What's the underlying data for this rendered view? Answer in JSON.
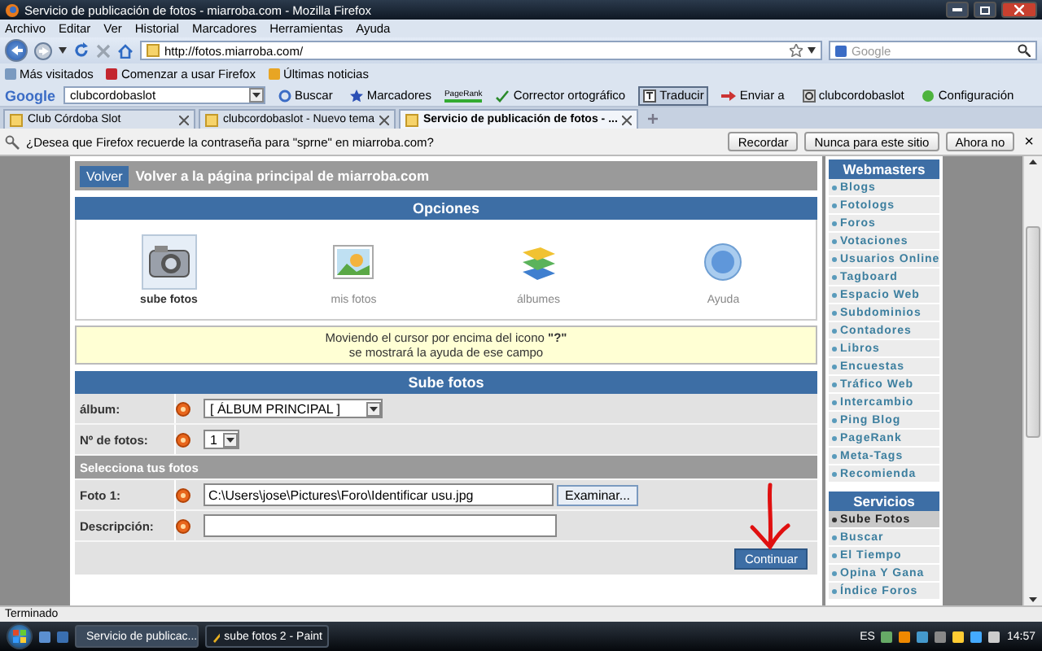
{
  "window": {
    "title": "Servicio de publicación de fotos - miarroba.com - Mozilla Firefox"
  },
  "menu": [
    "Archivo",
    "Editar",
    "Ver",
    "Historial",
    "Marcadores",
    "Herramientas",
    "Ayuda"
  ],
  "address_bar": {
    "url": "http://fotos.miarroba.com/"
  },
  "search_field": {
    "placeholder": "Google"
  },
  "bookmarks": [
    "Más visitados",
    "Comenzar a usar Firefox",
    "Últimas noticias"
  ],
  "google_toolbar": {
    "logo": "Google",
    "query": "clubcordobaslot",
    "items": [
      {
        "label": "Buscar",
        "kind": "search",
        "pressed": false
      },
      {
        "label": "Marcadores",
        "kind": "star",
        "pressed": false
      },
      {
        "label": "PageRank",
        "kind": "pagerank",
        "pressed": false
      },
      {
        "label": "Corrector ortográfico",
        "kind": "spell",
        "pressed": false
      },
      {
        "label": "Traducir",
        "kind": "translate",
        "pressed": true
      },
      {
        "label": "Enviar a",
        "kind": "send",
        "pressed": false
      },
      {
        "label": "clubcordobaslot",
        "kind": "page",
        "pressed": false
      },
      {
        "label": "Configuración",
        "kind": "settings",
        "pressed": false
      }
    ]
  },
  "tabs": [
    {
      "label": "Club Córdoba Slot",
      "selected": false
    },
    {
      "label": "clubcordobaslot - Nuevo tema",
      "selected": false
    },
    {
      "label": "Servicio de publicación de fotos - ...",
      "selected": true
    }
  ],
  "notification": {
    "message": "¿Desea que Firefox recuerde la contraseña para \"sprne\" en miarroba.com?",
    "buttons": [
      "Recordar",
      "Nunca para este sitio",
      "Ahora no"
    ],
    "close": "×"
  },
  "page": {
    "back_button": "Volver",
    "back_text": "Volver a la página principal de miarroba.com",
    "options": {
      "title": "Opciones",
      "items": [
        {
          "label": "sube fotos",
          "kind": "camera",
          "selected": true
        },
        {
          "label": "mis fotos",
          "kind": "photo",
          "selected": false
        },
        {
          "label": "álbumes",
          "kind": "books",
          "selected": false
        },
        {
          "label": "Ayuda",
          "kind": "help",
          "selected": false
        }
      ]
    },
    "hint": [
      "Moviendo el cursor por encima del icono **\"?\"**",
      "se mostrará la ayuda de ese campo"
    ],
    "form": {
      "title": "Sube fotos",
      "rows": [
        {
          "kind": "select",
          "label": "álbum:",
          "value": "[ ÁLBUM PRINCIPAL ]"
        },
        {
          "kind": "select",
          "label": "Nº de fotos:",
          "value": "1"
        },
        {
          "kind": "section",
          "label": "Selecciona tus fotos"
        },
        {
          "kind": "file",
          "label": "Foto 1:",
          "value": "C:\\Users\\jose\\Pictures\\Foro\\Identificar usu.jpg",
          "button": "Examinar..."
        },
        {
          "kind": "input",
          "label": "Descripción:"
        }
      ],
      "submit": "Continuar"
    }
  },
  "sidebar": {
    "sections": [
      {
        "title": "Webmasters",
        "items": [
          {
            "label": "Blogs",
            "selected": false
          },
          {
            "label": "Fotologs",
            "selected": false
          },
          {
            "label": "Foros",
            "selected": false
          },
          {
            "label": "Votaciones",
            "selected": false
          },
          {
            "label": "Usuarios Online",
            "selected": false
          },
          {
            "label": "Tagboard",
            "selected": false
          },
          {
            "label": "Espacio Web",
            "selected": false
          },
          {
            "label": "Subdominios",
            "selected": false
          },
          {
            "label": "Contadores",
            "selected": false
          },
          {
            "label": "Libros",
            "selected": false
          },
          {
            "label": "Encuestas",
            "selected": false
          },
          {
            "label": "Tráfico Web",
            "selected": false
          },
          {
            "label": "Intercambio",
            "selected": false
          },
          {
            "label": "Ping Blog",
            "selected": false
          },
          {
            "label": "PageRank",
            "selected": false
          },
          {
            "label": "Meta-Tags",
            "selected": false
          },
          {
            "label": "Recomienda",
            "selected": false
          }
        ]
      },
      {
        "title": "Servicios",
        "items": [
          {
            "label": "Sube Fotos",
            "selected": true
          },
          {
            "label": "Buscar",
            "selected": false
          },
          {
            "label": "El Tiempo",
            "selected": false
          },
          {
            "label": "Opina Y Gana",
            "selected": false
          },
          {
            "label": "Índice Foros",
            "selected": false
          }
        ]
      }
    ]
  },
  "status_bar": {
    "text": "Terminado"
  },
  "taskbar": {
    "windows": [
      {
        "label": "Servicio de publicac...",
        "kind": "firefox",
        "selected": true
      },
      {
        "label": "sube fotos 2 - Paint",
        "kind": "paint",
        "selected": false
      }
    ],
    "language": "ES",
    "clock": "14:57"
  }
}
